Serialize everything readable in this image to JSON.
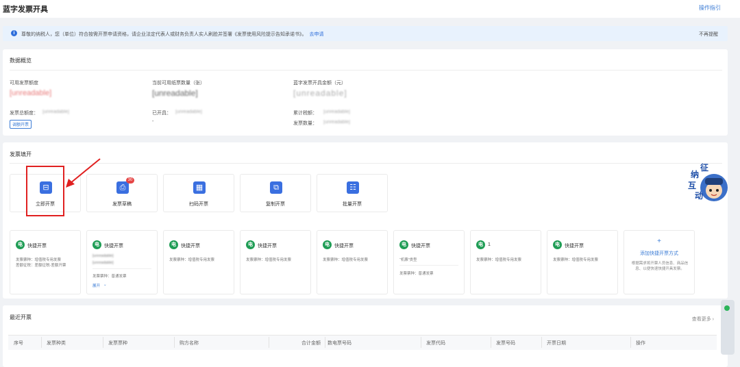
{
  "header": {
    "title": "蓝字发票开具",
    "guide": "操作指引"
  },
  "notice": {
    "icon": "info-icon",
    "text": "尊敬的纳税人，您（单位）符合按需开票申请资格，请企业法定代表人或财务负责人实人刷脸并签署《发票使用风险提示告知承诺书》。",
    "link": "去申请",
    "close": "不再提醒"
  },
  "overview": {
    "title": "数据概览",
    "available_amount_label": "可用发票额度",
    "available_amount_value": "[unreadable]",
    "total_amount_label": "发票总额度：",
    "total_amount_value": "[unreadable]",
    "adjust_btn": "调额开票",
    "paper_count_label": "当前可用纸票数量（张）",
    "paper_count_value": "[unreadable]",
    "issued_label": "已开具：",
    "issued_value": "[unreadable]",
    "issued_extra": "-",
    "blue_amount_label": "蓝字发票开具金额（元）",
    "blue_amount_value": "[unreadable]",
    "tax_label": "累计税额：",
    "tax_value": "[unreadable]",
    "invoice_count_label": "发票数量：",
    "invoice_count_value": "[unreadable]"
  },
  "actions": {
    "title": "发票填开",
    "tiles": [
      {
        "label": "立即开票",
        "icon": "invoice-issue-icon"
      },
      {
        "label": "发票草稿",
        "icon": "draft-icon",
        "badge": "30"
      },
      {
        "label": "扫码开票",
        "icon": "qr-code-icon"
      },
      {
        "label": "复制开票",
        "icon": "copy-icon"
      },
      {
        "label": "批量开票",
        "icon": "batch-icon"
      }
    ]
  },
  "quick": {
    "icon_char": "电",
    "cards": [
      {
        "title": "快捷开票",
        "l1": "发票票种：增值税专用发票",
        "l2": "差额征税：差额征税-差额开票"
      },
      {
        "title": "快捷开票",
        "l1": "[unreadable]",
        "l2": "[unreadable]",
        "l3": "发票票种：普通发票",
        "expand": "展开"
      },
      {
        "title": "快捷开票",
        "l1": "发票票种：增值税专用发票"
      },
      {
        "title": "快捷开票",
        "l1": "发票票种：增值税专用发票"
      },
      {
        "title": "快捷开票",
        "l1": "发票票种：增值税专用发票"
      },
      {
        "title": "快捷开票",
        "l1": "“机票”类型",
        "l2": "发票票种：普通发票"
      },
      {
        "title": "1",
        "l1": "发票票种：增值税专用发票"
      },
      {
        "title": "快捷开票",
        "l1": "发票票种：增值税专用发票"
      }
    ],
    "add": {
      "plus": "+",
      "title": "添加快捷开票方式",
      "desc": "根据需求将开票人员信息、商品信息、以便快速快捷开具发票。"
    }
  },
  "recent": {
    "title": "最近开票",
    "more": "查看更多 ›",
    "columns": [
      "序号",
      "发票种类",
      "发票票种",
      "购方名称",
      "合计金额",
      "数电票号码",
      "发票代码",
      "发票号码",
      "开票日期",
      "操作"
    ]
  },
  "mascot": {
    "chars": [
      "征",
      "纳",
      "互",
      "动"
    ]
  },
  "colors": {
    "primary": "#3a6fe0",
    "danger": "#e04848",
    "green": "#1f9d55"
  }
}
